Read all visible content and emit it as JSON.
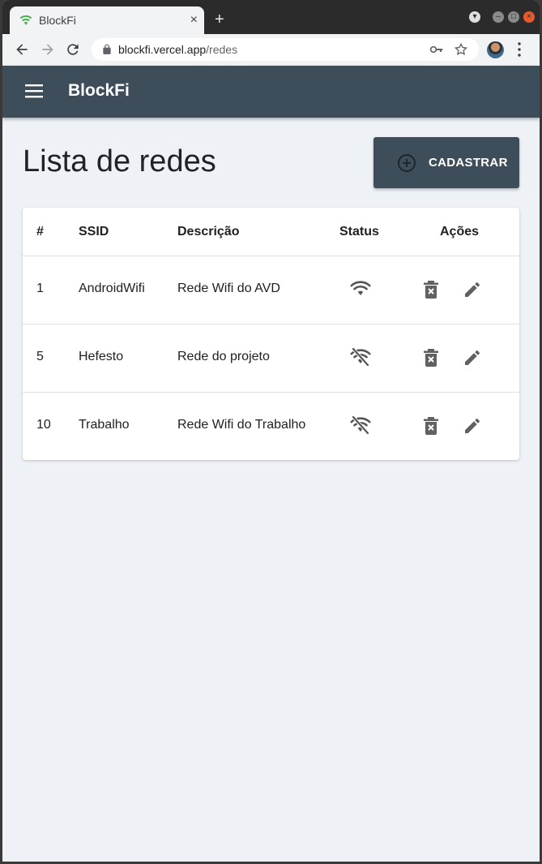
{
  "browser": {
    "tab_title": "BlockFi",
    "tab_close": "×",
    "new_tab": "+",
    "url_host": "blockfi.vercel.app",
    "url_path": "/redes"
  },
  "app": {
    "title": "BlockFi",
    "colors": {
      "appbar": "#3e4d5a",
      "background": "#eef1f6"
    }
  },
  "page": {
    "title": "Lista de redes",
    "cadastrar_label": "CADASTRAR"
  },
  "table": {
    "headers": {
      "id": "#",
      "ssid": "SSID",
      "descricao": "Descrição",
      "status": "Status",
      "acoes": "Ações"
    },
    "rows": [
      {
        "id": "1",
        "ssid": "AndroidWifi",
        "descricao": "Rede Wifi do AVD",
        "status": "wifi-on-icon"
      },
      {
        "id": "5",
        "ssid": "Hefesto",
        "descricao": "Rede do projeto",
        "status": "wifi-off-icon"
      },
      {
        "id": "10",
        "ssid": "Trabalho",
        "descricao": "Rede Wifi do Trabalho",
        "status": "wifi-off-icon"
      }
    ]
  }
}
